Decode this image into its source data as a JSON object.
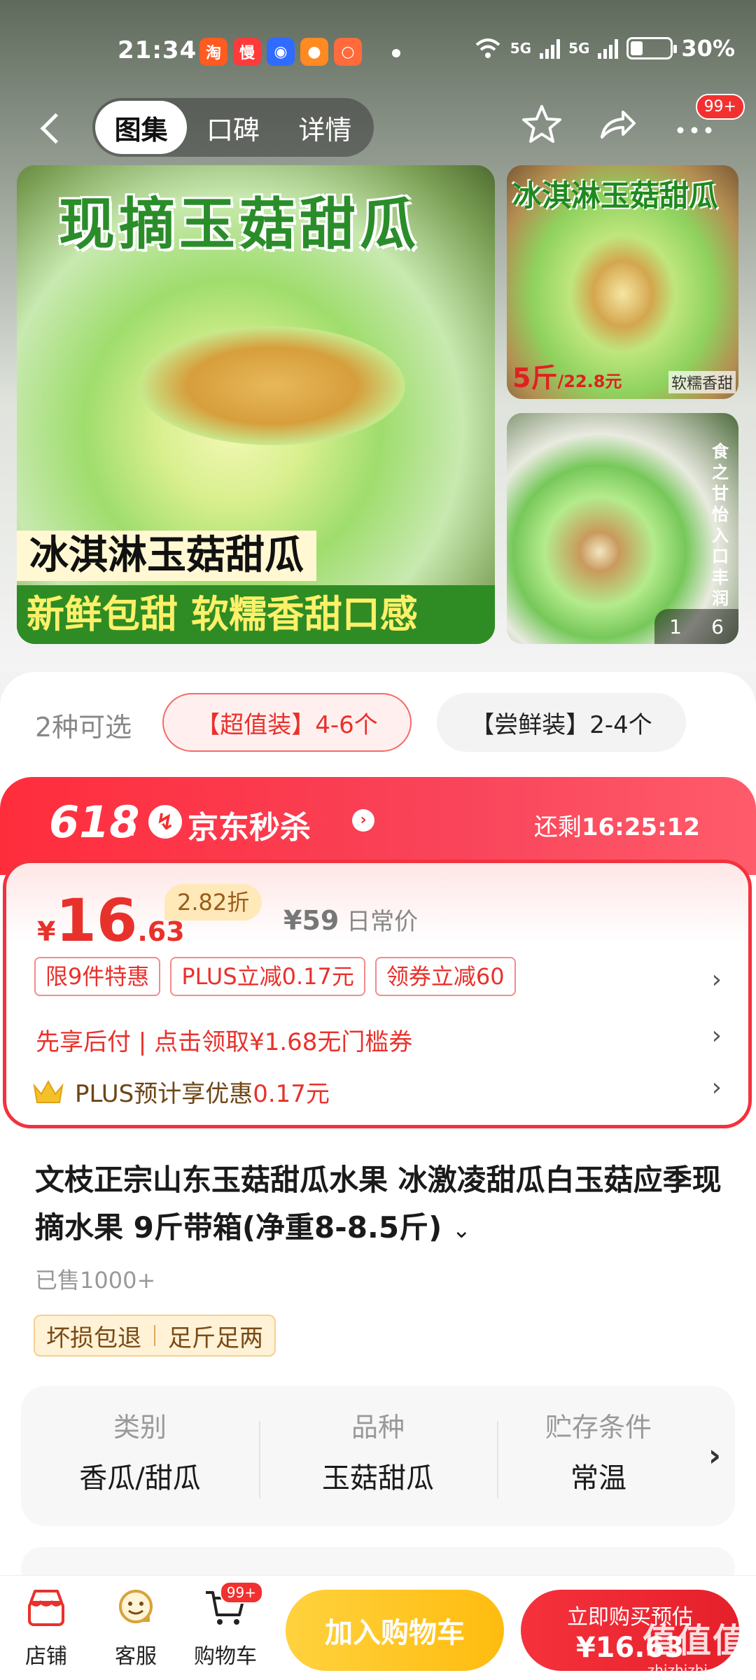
{
  "status_bar": {
    "time": "21:34",
    "battery": "30%",
    "battery_fraction": 0.3,
    "signal_1": "5G",
    "signal_2": "5G",
    "app_icons": [
      "taobao-icon",
      "manman-icon",
      "baidu-icon",
      "app-icon-orange",
      "app-icon-peach"
    ]
  },
  "navbar": {
    "tabs": [
      "图集",
      "口碑",
      "详情"
    ],
    "active_tab": "图集",
    "badge": "99+"
  },
  "gallery": {
    "main_title": "现摘玉菇甜瓜",
    "caption_1": "冰淇淋玉菇甜瓜",
    "caption_2a": "新鲜包甜",
    "caption_2b": "软糯香甜口感",
    "side1_title": "冰淇淋玉菇甜瓜",
    "side1_price": "5斤",
    "side1_price_small": "/22.8元",
    "side1_note": "软糯香甜",
    "side2_vertical": "食之甘怡 入口丰润",
    "page_current": "1",
    "page_total": "6"
  },
  "variants": {
    "label": "2种可选",
    "options": [
      "【超值装】4-6个",
      "【尝鲜装】2-4个"
    ],
    "selected_index": 0
  },
  "flash_sale": {
    "badge_618": "618",
    "title": "京东秒杀",
    "remain_label": "还剩",
    "remain_time": "16:25:12"
  },
  "price": {
    "currency": "¥",
    "integer": "16",
    "decimal": ".63",
    "discount": "2.82折",
    "original": "¥59",
    "original_label": "日常价",
    "tags": [
      "限9件特惠",
      "PLUS立减0.17元",
      "领券立减60"
    ],
    "credit_text": "先享后付 | 点击领取¥1.68无门槛券",
    "plus_text": "PLUS预计享优惠",
    "plus_amount": "0.17元"
  },
  "product": {
    "title": "文枝正宗山东玉菇甜瓜水果 冰激凌甜瓜白玉菇应季现摘水果 9斤带箱(净重8-8.5斤)",
    "sold": "已售1000+",
    "services": [
      "坏损包退",
      "足斤足两"
    ]
  },
  "attributes": [
    {
      "key": "类别",
      "value": "香瓜/甜瓜"
    },
    {
      "key": "品种",
      "value": "玉菇甜瓜"
    },
    {
      "key": "贮存条件",
      "value": "常温"
    }
  ],
  "bottom_bar": {
    "shop": "店铺",
    "service": "客服",
    "cart": "购物车",
    "cart_badge": "99+",
    "add_to_cart": "加入购物车",
    "buy_line1": "立即购买预估",
    "buy_line2": "¥16.63"
  },
  "watermark": {
    "logo": "值值值",
    "site": "zhizhizhi.com"
  },
  "colors": {
    "accent_red": "#e9312b",
    "button_yellow": "#ffc21c",
    "melon_green": "#2f8c24"
  }
}
